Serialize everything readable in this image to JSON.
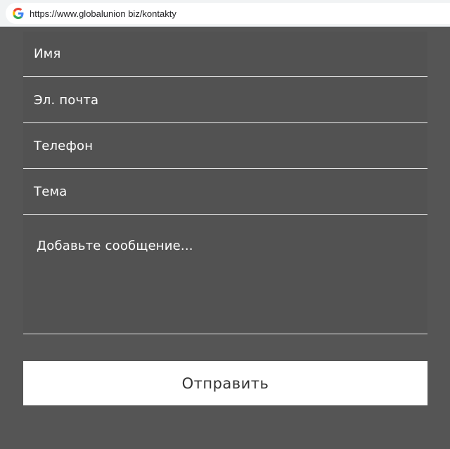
{
  "browser": {
    "url": "https://www.globalunion biz/kontakty",
    "favicon": "google-g-icon"
  },
  "form": {
    "fields": [
      {
        "label": "Имя"
      },
      {
        "label": "Эл. почта"
      },
      {
        "label": "Телефон"
      },
      {
        "label": "Тема"
      }
    ],
    "message_placeholder": "Добавьте сообщение...",
    "submit_label": "Отправить"
  },
  "colors": {
    "background": "#555555",
    "field_background": "#525252",
    "divider": "#e6e6e6",
    "button_background": "#ffffff",
    "button_text": "#333333",
    "text": "#ffffff"
  }
}
